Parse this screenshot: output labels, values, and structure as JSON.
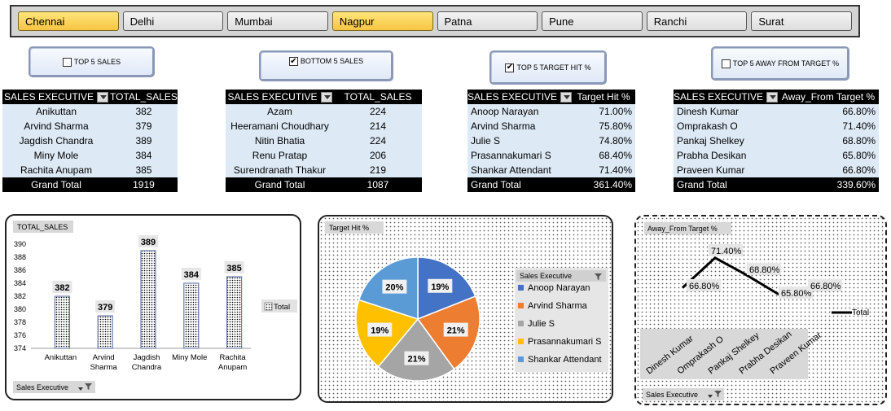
{
  "slicer": {
    "items": [
      {
        "label": "Chennai",
        "selected": true
      },
      {
        "label": "Delhi",
        "selected": false
      },
      {
        "label": "Mumbai",
        "selected": false
      },
      {
        "label": "Nagpur",
        "selected": true
      },
      {
        "label": "Patna",
        "selected": false
      },
      {
        "label": "Pune",
        "selected": false
      },
      {
        "label": "Ranchi",
        "selected": false
      },
      {
        "label": "Surat",
        "selected": false
      }
    ]
  },
  "buttons": {
    "top5_sales": {
      "label": "TOP 5 SALES",
      "checked": false
    },
    "bottom5_sales": {
      "label": "BOTTOM  5 SALES",
      "checked": true
    },
    "top5_target": {
      "label": "TOP 5 TARGET HIT %",
      "checked": true
    },
    "top5_away": {
      "label": "TOP 5 AWAY FROM TARGET %",
      "checked": false
    }
  },
  "table1": {
    "headers": [
      "SALES  EXECUTIVE",
      "TOTAL_SALES"
    ],
    "rows": [
      [
        "Anikuttan",
        "382"
      ],
      [
        "Arvind Sharma",
        "379"
      ],
      [
        "Jagdish Chandra",
        "389"
      ],
      [
        "Miny Mole",
        "384"
      ],
      [
        "Rachita Anupam",
        "385"
      ]
    ],
    "total": [
      "Grand Total",
      "1919"
    ]
  },
  "table2": {
    "headers": [
      "SALES  EXECUTIVE",
      "TOTAL_SALES"
    ],
    "rows": [
      [
        "Azam",
        "224"
      ],
      [
        "Heeramani Choudhary",
        "214"
      ],
      [
        "Nitin Bhatia",
        "224"
      ],
      [
        "Renu Pratap",
        "206"
      ],
      [
        "Surendranath Thakur",
        "219"
      ]
    ],
    "total": [
      "Grand Total",
      "1087"
    ]
  },
  "table3": {
    "headers": [
      "SALES  EXECUTIVE",
      "Target Hit %"
    ],
    "rows": [
      [
        "Anoop Narayan",
        "71.00%"
      ],
      [
        "Arvind Sharma",
        "75.80%"
      ],
      [
        "Julie S",
        "74.80%"
      ],
      [
        "Prasannakumari S",
        "68.40%"
      ],
      [
        "Shankar Attendant",
        "71.40%"
      ]
    ],
    "total": [
      "Grand Total",
      "361.40%"
    ]
  },
  "table4": {
    "headers": [
      "SALES  EXECUTIVE",
      "Away_From Target %"
    ],
    "rows": [
      [
        "Dinesh Kumar",
        "66.80%"
      ],
      [
        "Omprakash O",
        "71.40%"
      ],
      [
        "Pankaj Shelkey",
        "68.80%"
      ],
      [
        "Prabha Desikan",
        "65.80%"
      ],
      [
        "Praveen Kumar",
        "66.80%"
      ]
    ],
    "total": [
      "Grand Total",
      "339.60%"
    ]
  },
  "chart_data": [
    {
      "type": "bar",
      "title": "TOTAL_SALES",
      "categories": [
        "Anikuttan",
        "Arvind Sharma",
        "Jagdish Chandra",
        "Miny Mole",
        "Rachita Anupam"
      ],
      "category_lines": [
        [
          "Anikuttan"
        ],
        [
          "Arvind",
          "Sharma"
        ],
        [
          "Jagdish",
          "Chandra"
        ],
        [
          "Miny Mole"
        ],
        [
          "Rachita",
          "Anupam"
        ]
      ],
      "series": [
        {
          "name": "Total",
          "values": [
            382,
            379,
            389,
            384,
            385
          ]
        }
      ],
      "ylim": [
        374,
        390
      ],
      "yticks": [
        374,
        376,
        378,
        380,
        382,
        384,
        386,
        388,
        390
      ],
      "filter_label": "Sales Executive",
      "legend_label": "Total"
    },
    {
      "type": "pie",
      "title": "Target Hit %",
      "categories": [
        "Anoop Narayan",
        "Arvind Sharma",
        "Julie S",
        "Prasannakumari S",
        "Shankar Attendant"
      ],
      "values": [
        19,
        21,
        21,
        19,
        20
      ],
      "labels": [
        "19%",
        "21%",
        "21%",
        "19%",
        "20%"
      ],
      "colors": [
        "#4472c4",
        "#ed7d31",
        "#a5a5a5",
        "#ffc000",
        "#5b9bd5"
      ],
      "legend_title": "Sales Executive"
    },
    {
      "type": "line",
      "title": "Away_From Target %",
      "categories": [
        "Dinesh Kumar",
        "Omprakash O",
        "Pankaj Shelkey",
        "Prabha Desikan",
        "Praveen Kumar"
      ],
      "values": [
        66.8,
        71.4,
        68.8,
        65.8,
        66.8
      ],
      "labels": [
        "66.80%",
        "71.40%",
        "68.80%",
        "65.80%",
        "66.80%"
      ],
      "legend_label": "Total",
      "filter_label": "Sales Executive"
    }
  ]
}
